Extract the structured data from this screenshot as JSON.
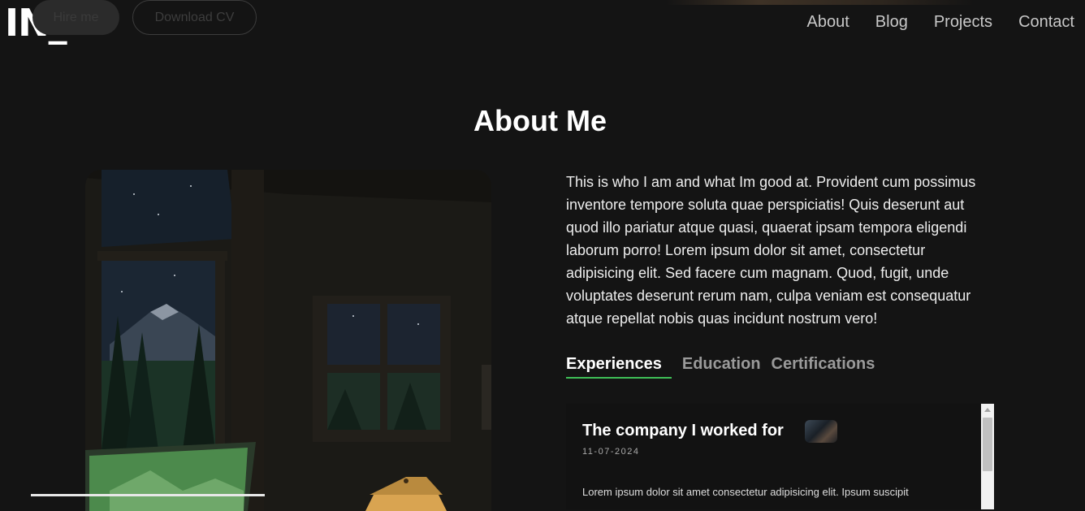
{
  "header": {
    "logo": "IN_",
    "hire_button": "Hire me",
    "cv_button": "Download CV",
    "nav": [
      "About",
      "Blog",
      "Projects",
      "Contact"
    ]
  },
  "about": {
    "title": "About Me",
    "bio": "This is who I am and what Im good at. Provident cum possimus inventore tempore soluta quae perspiciatis! Quis deserunt aut quod illo pariatur atque quasi, quaerat ipsam tempora eligendi laborum porro! Lorem ipsum dolor sit amet, consectetur adipisicing elit. Sed facere cum magnam. Quod, fugit, unde voluptates deserunt rerum nam, culpa veniam est consequatur atque repellat nobis quas incidunt nostrum vero!",
    "photo_icon": "illustrated-cabin-window-night-image",
    "tabs": [
      "Experiences",
      "Education",
      "Certifications"
    ],
    "active_tab": "Experiences",
    "experience": {
      "company": "The company I worked for",
      "date": "11-07-2024",
      "text": "Lorem ipsum dolor sit amet consectetur adipisicing elit. Ipsum suscipit"
    }
  },
  "colors": {
    "background": "#141414",
    "accent": "#3fbf57",
    "text": "#f2f2f2"
  }
}
